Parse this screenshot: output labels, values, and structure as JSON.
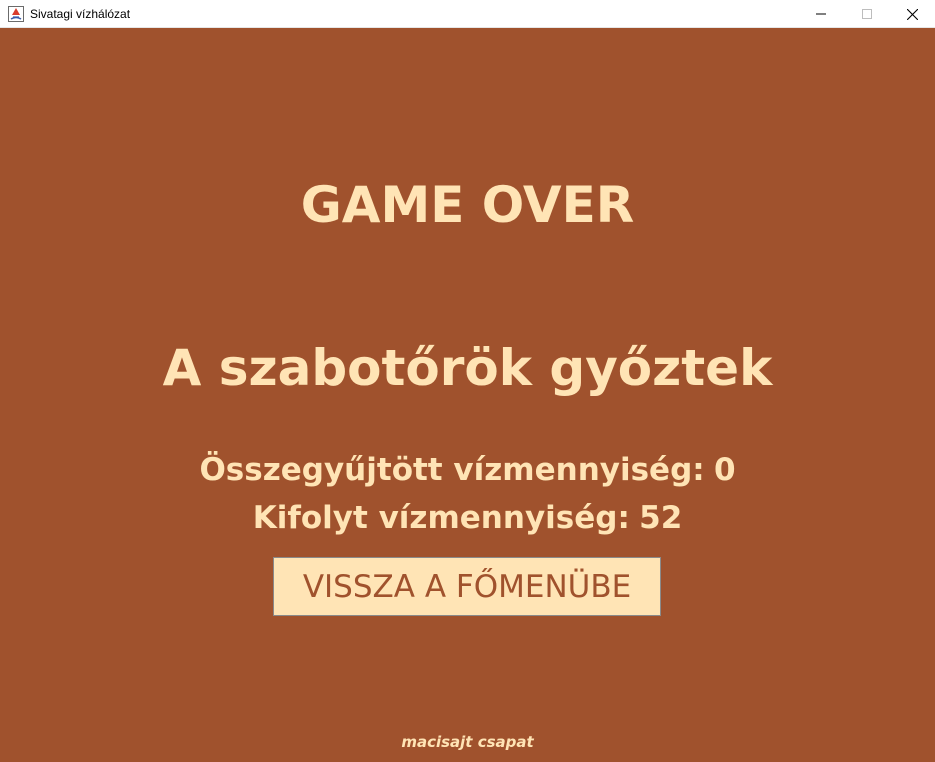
{
  "window": {
    "title": "Sivatagi vízhálózat",
    "icons": {
      "app": "java-app-icon",
      "minimize": "minimize-icon",
      "maximize": "maximize-icon",
      "close": "close-icon"
    }
  },
  "screen": {
    "heading": "GAME OVER",
    "result": "A szabotőrök győztek",
    "stats": {
      "collected_label": "Összegyűjtött vízmennyiség:",
      "collected_value": 0,
      "leaked_label": "Kifolyt vízmennyiség:",
      "leaked_value": 52
    },
    "back_button_label": "VISSZA A FŐMENÜBE",
    "credits": "macisajt csapat"
  },
  "colors": {
    "background": "#a0522d",
    "text": "#ffe4b5",
    "button_background": "#ffe4b5",
    "button_text": "#a0522d"
  }
}
